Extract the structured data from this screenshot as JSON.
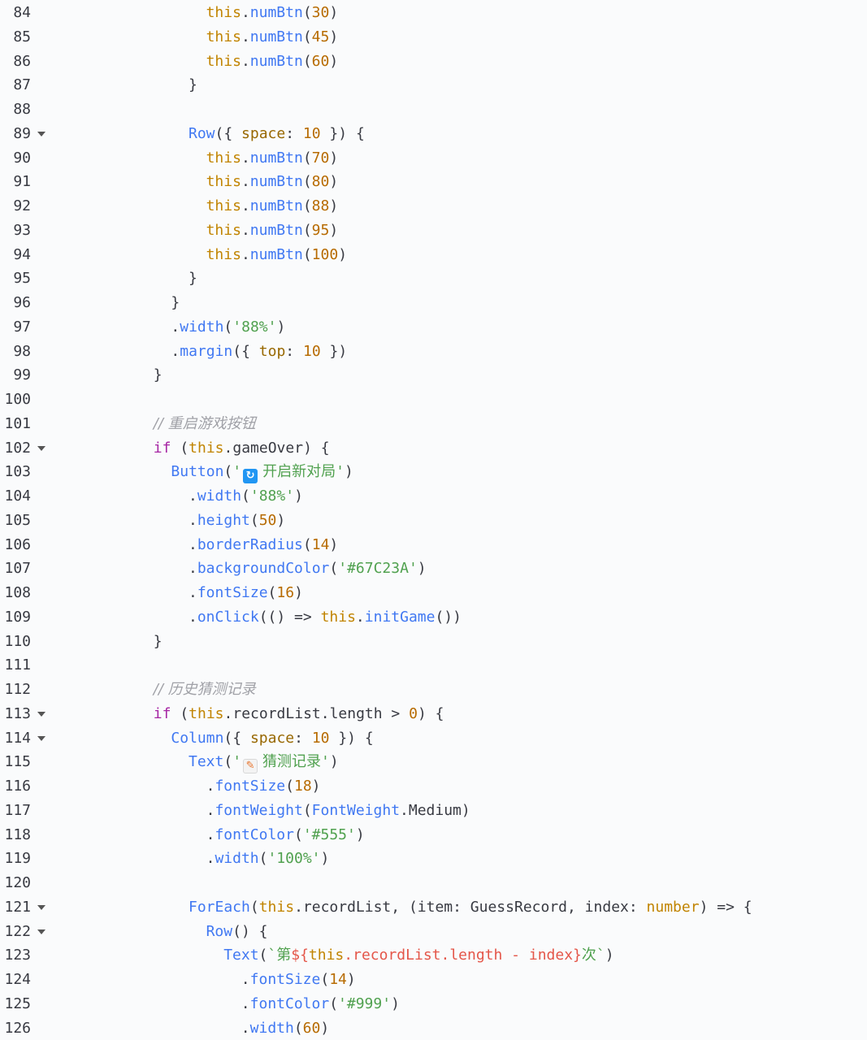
{
  "lines": [
    {
      "n": "84",
      "fold": false,
      "indent": 17,
      "tokens": [
        [
          "th",
          "this"
        ],
        [
          "op",
          "."
        ],
        [
          "fn",
          "numBtn"
        ],
        [
          "op",
          "("
        ],
        [
          "nm",
          "30"
        ],
        [
          "op",
          ")"
        ]
      ]
    },
    {
      "n": "85",
      "fold": false,
      "indent": 17,
      "tokens": [
        [
          "th",
          "this"
        ],
        [
          "op",
          "."
        ],
        [
          "fn",
          "numBtn"
        ],
        [
          "op",
          "("
        ],
        [
          "nm",
          "45"
        ],
        [
          "op",
          ")"
        ]
      ]
    },
    {
      "n": "86",
      "fold": false,
      "indent": 17,
      "tokens": [
        [
          "th",
          "this"
        ],
        [
          "op",
          "."
        ],
        [
          "fn",
          "numBtn"
        ],
        [
          "op",
          "("
        ],
        [
          "nm",
          "60"
        ],
        [
          "op",
          ")"
        ]
      ]
    },
    {
      "n": "87",
      "fold": false,
      "indent": 15,
      "tokens": [
        [
          "op",
          "}"
        ]
      ]
    },
    {
      "n": "88",
      "fold": false,
      "indent": 0,
      "tokens": []
    },
    {
      "n": "89",
      "fold": true,
      "indent": 15,
      "tokens": [
        [
          "fn",
          "Row"
        ],
        [
          "op",
          "({ "
        ],
        [
          "key",
          "space"
        ],
        [
          "op",
          ": "
        ],
        [
          "nm",
          "10"
        ],
        [
          "op",
          " }) {"
        ]
      ]
    },
    {
      "n": "90",
      "fold": false,
      "indent": 17,
      "tokens": [
        [
          "th",
          "this"
        ],
        [
          "op",
          "."
        ],
        [
          "fn",
          "numBtn"
        ],
        [
          "op",
          "("
        ],
        [
          "nm",
          "70"
        ],
        [
          "op",
          ")"
        ]
      ]
    },
    {
      "n": "91",
      "fold": false,
      "indent": 17,
      "tokens": [
        [
          "th",
          "this"
        ],
        [
          "op",
          "."
        ],
        [
          "fn",
          "numBtn"
        ],
        [
          "op",
          "("
        ],
        [
          "nm",
          "80"
        ],
        [
          "op",
          ")"
        ]
      ]
    },
    {
      "n": "92",
      "fold": false,
      "indent": 17,
      "tokens": [
        [
          "th",
          "this"
        ],
        [
          "op",
          "."
        ],
        [
          "fn",
          "numBtn"
        ],
        [
          "op",
          "("
        ],
        [
          "nm",
          "88"
        ],
        [
          "op",
          ")"
        ]
      ]
    },
    {
      "n": "93",
      "fold": false,
      "indent": 17,
      "tokens": [
        [
          "th",
          "this"
        ],
        [
          "op",
          "."
        ],
        [
          "fn",
          "numBtn"
        ],
        [
          "op",
          "("
        ],
        [
          "nm",
          "95"
        ],
        [
          "op",
          ")"
        ]
      ]
    },
    {
      "n": "94",
      "fold": false,
      "indent": 17,
      "tokens": [
        [
          "th",
          "this"
        ],
        [
          "op",
          "."
        ],
        [
          "fn",
          "numBtn"
        ],
        [
          "op",
          "("
        ],
        [
          "nm",
          "100"
        ],
        [
          "op",
          ")"
        ]
      ]
    },
    {
      "n": "95",
      "fold": false,
      "indent": 15,
      "tokens": [
        [
          "op",
          "}"
        ]
      ]
    },
    {
      "n": "96",
      "fold": false,
      "indent": 13,
      "tokens": [
        [
          "op",
          "}"
        ]
      ]
    },
    {
      "n": "97",
      "fold": false,
      "indent": 13,
      "tokens": [
        [
          "op",
          "."
        ],
        [
          "pr",
          "width"
        ],
        [
          "op",
          "("
        ],
        [
          "st",
          "'88%'"
        ],
        [
          "op",
          ")"
        ]
      ]
    },
    {
      "n": "98",
      "fold": false,
      "indent": 13,
      "tokens": [
        [
          "op",
          "."
        ],
        [
          "pr",
          "margin"
        ],
        [
          "op",
          "({ "
        ],
        [
          "key",
          "top"
        ],
        [
          "op",
          ": "
        ],
        [
          "nm",
          "10"
        ],
        [
          "op",
          " })"
        ]
      ]
    },
    {
      "n": "99",
      "fold": false,
      "indent": 11,
      "tokens": [
        [
          "op",
          "}"
        ]
      ]
    },
    {
      "n": "100",
      "fold": false,
      "indent": 0,
      "tokens": []
    },
    {
      "n": "101",
      "fold": false,
      "indent": 11,
      "tokens": [
        [
          "cm",
          "// 重启游戏按钮"
        ]
      ]
    },
    {
      "n": "102",
      "fold": true,
      "indent": 11,
      "tokens": [
        [
          "kw",
          "if"
        ],
        [
          "op",
          " ("
        ],
        [
          "th",
          "this"
        ],
        [
          "op",
          ".gameOver) {"
        ]
      ]
    },
    {
      "n": "103",
      "fold": false,
      "indent": 13,
      "tokens": [
        [
          "fn",
          "Button"
        ],
        [
          "op",
          "("
        ],
        [
          "st",
          "'"
        ],
        [
          "emoji-refresh",
          "🔄"
        ],
        [
          "st",
          "开启新对局'"
        ],
        [
          "op",
          ")"
        ]
      ]
    },
    {
      "n": "104",
      "fold": false,
      "indent": 15,
      "tokens": [
        [
          "op",
          "."
        ],
        [
          "pr",
          "width"
        ],
        [
          "op",
          "("
        ],
        [
          "st",
          "'88%'"
        ],
        [
          "op",
          ")"
        ]
      ]
    },
    {
      "n": "105",
      "fold": false,
      "indent": 15,
      "tokens": [
        [
          "op",
          "."
        ],
        [
          "pr",
          "height"
        ],
        [
          "op",
          "("
        ],
        [
          "nm",
          "50"
        ],
        [
          "op",
          ")"
        ]
      ]
    },
    {
      "n": "106",
      "fold": false,
      "indent": 15,
      "tokens": [
        [
          "op",
          "."
        ],
        [
          "pr",
          "borderRadius"
        ],
        [
          "op",
          "("
        ],
        [
          "nm",
          "14"
        ],
        [
          "op",
          ")"
        ]
      ]
    },
    {
      "n": "107",
      "fold": false,
      "indent": 15,
      "tokens": [
        [
          "op",
          "."
        ],
        [
          "pr",
          "backgroundColor"
        ],
        [
          "op",
          "("
        ],
        [
          "st",
          "'#67C23A'"
        ],
        [
          "op",
          ")"
        ]
      ]
    },
    {
      "n": "108",
      "fold": false,
      "indent": 15,
      "tokens": [
        [
          "op",
          "."
        ],
        [
          "pr",
          "fontSize"
        ],
        [
          "op",
          "("
        ],
        [
          "nm",
          "16"
        ],
        [
          "op",
          ")"
        ]
      ]
    },
    {
      "n": "109",
      "fold": false,
      "indent": 15,
      "tokens": [
        [
          "op",
          "."
        ],
        [
          "pr",
          "onClick"
        ],
        [
          "op",
          "(() => "
        ],
        [
          "th",
          "this"
        ],
        [
          "op",
          "."
        ],
        [
          "fn",
          "initGame"
        ],
        [
          "op",
          "())"
        ]
      ]
    },
    {
      "n": "110",
      "fold": false,
      "indent": 11,
      "tokens": [
        [
          "op",
          "}"
        ]
      ]
    },
    {
      "n": "111",
      "fold": false,
      "indent": 0,
      "tokens": []
    },
    {
      "n": "112",
      "fold": false,
      "indent": 11,
      "tokens": [
        [
          "cm",
          "// 历史猜测记录"
        ]
      ]
    },
    {
      "n": "113",
      "fold": true,
      "indent": 11,
      "tokens": [
        [
          "kw",
          "if"
        ],
        [
          "op",
          " ("
        ],
        [
          "th",
          "this"
        ],
        [
          "op",
          ".recordList.length > "
        ],
        [
          "nm",
          "0"
        ],
        [
          "op",
          ") {"
        ]
      ]
    },
    {
      "n": "114",
      "fold": true,
      "indent": 13,
      "tokens": [
        [
          "fn",
          "Column"
        ],
        [
          "op",
          "({ "
        ],
        [
          "key",
          "space"
        ],
        [
          "op",
          ": "
        ],
        [
          "nm",
          "10"
        ],
        [
          "op",
          " }) {"
        ]
      ]
    },
    {
      "n": "115",
      "fold": false,
      "indent": 15,
      "tokens": [
        [
          "fn",
          "Text"
        ],
        [
          "op",
          "("
        ],
        [
          "st",
          "'"
        ],
        [
          "emoji-memo",
          "📝"
        ],
        [
          "st",
          "猜测记录'"
        ],
        [
          "op",
          ")"
        ]
      ]
    },
    {
      "n": "116",
      "fold": false,
      "indent": 17,
      "tokens": [
        [
          "op",
          "."
        ],
        [
          "pr",
          "fontSize"
        ],
        [
          "op",
          "("
        ],
        [
          "nm",
          "18"
        ],
        [
          "op",
          ")"
        ]
      ]
    },
    {
      "n": "117",
      "fold": false,
      "indent": 17,
      "tokens": [
        [
          "op",
          "."
        ],
        [
          "pr",
          "fontWeight"
        ],
        [
          "op",
          "("
        ],
        [
          "fn",
          "FontWeight"
        ],
        [
          "op",
          ".Medium)"
        ]
      ]
    },
    {
      "n": "118",
      "fold": false,
      "indent": 17,
      "tokens": [
        [
          "op",
          "."
        ],
        [
          "pr",
          "fontColor"
        ],
        [
          "op",
          "("
        ],
        [
          "st",
          "'#555'"
        ],
        [
          "op",
          ")"
        ]
      ]
    },
    {
      "n": "119",
      "fold": false,
      "indent": 17,
      "tokens": [
        [
          "op",
          "."
        ],
        [
          "pr",
          "width"
        ],
        [
          "op",
          "("
        ],
        [
          "st",
          "'100%'"
        ],
        [
          "op",
          ")"
        ]
      ]
    },
    {
      "n": "120",
      "fold": false,
      "indent": 0,
      "tokens": []
    },
    {
      "n": "121",
      "fold": true,
      "indent": 15,
      "tokens": [
        [
          "fn",
          "ForEach"
        ],
        [
          "op",
          "("
        ],
        [
          "th",
          "this"
        ],
        [
          "op",
          ".recordList, (item: GuessRecord, index: "
        ],
        [
          "ty",
          "number"
        ],
        [
          "op",
          ") => {"
        ]
      ]
    },
    {
      "n": "122",
      "fold": true,
      "indent": 17,
      "tokens": [
        [
          "fn",
          "Row"
        ],
        [
          "op",
          "() {"
        ]
      ]
    },
    {
      "n": "123",
      "fold": false,
      "indent": 19,
      "tokens": [
        [
          "fn",
          "Text"
        ],
        [
          "op",
          "("
        ],
        [
          "st",
          "`第"
        ],
        [
          "tpl",
          "${"
        ],
        [
          "th",
          "this"
        ],
        [
          "tpl",
          ".recordList.length - index}"
        ],
        [
          "st",
          "次`"
        ],
        [
          "op",
          ")"
        ]
      ]
    },
    {
      "n": "124",
      "fold": false,
      "indent": 21,
      "tokens": [
        [
          "op",
          "."
        ],
        [
          "pr",
          "fontSize"
        ],
        [
          "op",
          "("
        ],
        [
          "nm",
          "14"
        ],
        [
          "op",
          ")"
        ]
      ]
    },
    {
      "n": "125",
      "fold": false,
      "indent": 21,
      "tokens": [
        [
          "op",
          "."
        ],
        [
          "pr",
          "fontColor"
        ],
        [
          "op",
          "("
        ],
        [
          "st",
          "'#999'"
        ],
        [
          "op",
          ")"
        ]
      ]
    },
    {
      "n": "126",
      "fold": false,
      "indent": 21,
      "tokens": [
        [
          "op",
          "."
        ],
        [
          "pr",
          "width"
        ],
        [
          "op",
          "("
        ],
        [
          "nm",
          "60"
        ],
        [
          "op",
          ")"
        ]
      ]
    }
  ]
}
